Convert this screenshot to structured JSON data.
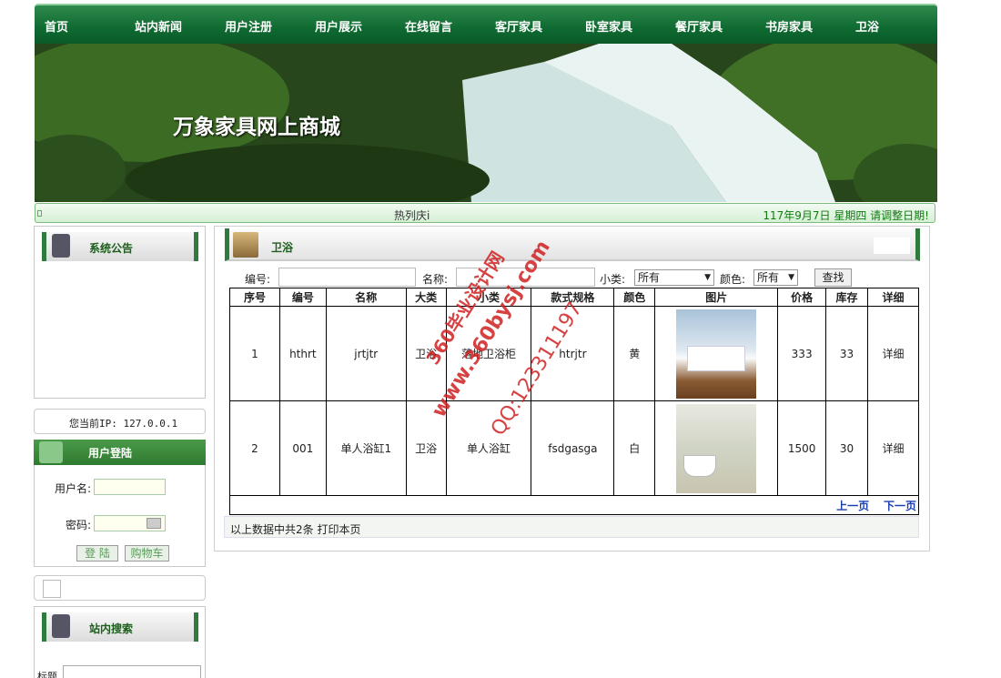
{
  "nav": [
    "首页",
    "站内新闻",
    "用户注册",
    "用户展示",
    "在线留言",
    "客厅家具",
    "卧室家具",
    "餐厅家具",
    "书房家具",
    "卫浴"
  ],
  "banner": {
    "title": "万象家具网上商城"
  },
  "ticker": {
    "text": "热列庆i",
    "date": "117年9月7日 星期四 请调整日期!"
  },
  "sidebar": {
    "notice_title": "系统公告",
    "ip_text": "您当前IP: 127.0.0.1",
    "login_title": "用户登陆",
    "username_label": "用户名:",
    "password_label": "密码:",
    "login_button": "登 陆",
    "cart_button": "购物车",
    "search_title": "站内搜索",
    "search_label": "标题"
  },
  "main": {
    "title": "卫浴",
    "filters": {
      "code_label": "编号:",
      "name_label": "名称:",
      "subcat_label": "小类:",
      "subcat_value": "所有",
      "color_label": "颜色:",
      "color_value": "所有",
      "find_button": "查找"
    },
    "columns": [
      "序号",
      "编号",
      "名称",
      "大类",
      "小类",
      "款式规格",
      "颜色",
      "图片",
      "价格",
      "库存",
      "详细"
    ],
    "rows": [
      {
        "no": "1",
        "code": "hthrt",
        "name": "jrtjtr",
        "cat": "卫浴",
        "subcat": "落地卫浴柜",
        "spec": "htrjtr",
        "color": "黄",
        "price": "333",
        "stock": "33",
        "detail": "详细"
      },
      {
        "no": "2",
        "code": "001",
        "name": "单人浴缸1",
        "cat": "卫浴",
        "subcat": "单人浴缸",
        "spec": "fsdgasga",
        "color": "白",
        "price": "1500",
        "stock": "30",
        "detail": "详细"
      }
    ],
    "pager": {
      "prev": "上一页",
      "next": "下一页"
    },
    "summary": "以上数据中共2条 打印本页"
  },
  "watermark": [
    "360毕业设计网",
    "www.360bysj.com",
    "QQ:123311197"
  ]
}
